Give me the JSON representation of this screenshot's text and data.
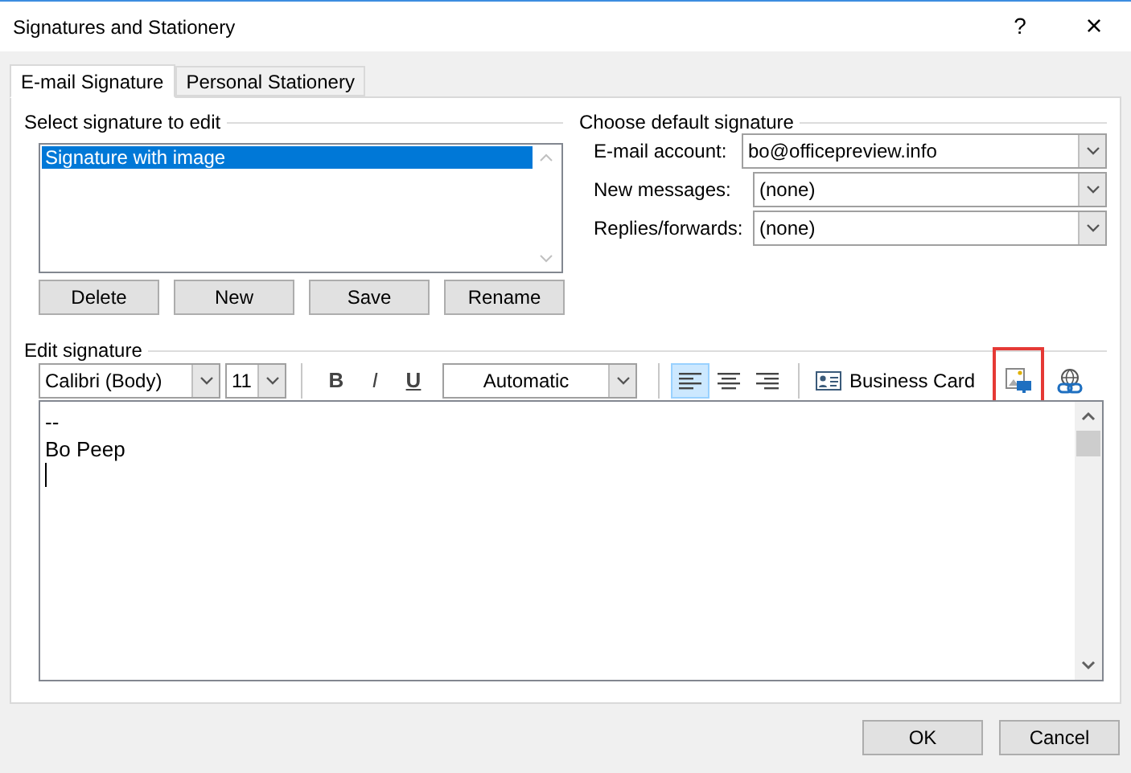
{
  "window": {
    "title": "Signatures and Stationery",
    "help": "?",
    "close": "×"
  },
  "tabs": [
    {
      "label": "E-mail Signature",
      "selected": true
    },
    {
      "label": "Personal Stationery",
      "selected": false
    }
  ],
  "select_signature": {
    "heading": "Select signature to edit",
    "items": [
      {
        "label": "Signature with image",
        "selected": true
      }
    ],
    "buttons": [
      "Delete",
      "New",
      "Save",
      "Rename"
    ]
  },
  "default_signature": {
    "heading": "Choose default signature",
    "fields": [
      {
        "label": "E-mail account:",
        "value": "bo@officepreview.info"
      },
      {
        "label": "New messages:",
        "value": "(none)"
      },
      {
        "label": "Replies/forwards:",
        "value": "(none)"
      }
    ]
  },
  "edit_signature": {
    "heading": "Edit signature",
    "font": "Calibri (Body)",
    "size": "11",
    "font_color": "Automatic",
    "tools": [
      {
        "kind": "bold",
        "label": "B",
        "selected": false,
        "highlighted": false
      },
      {
        "kind": "italic",
        "label": "I",
        "selected": false,
        "highlighted": false
      },
      {
        "kind": "underline",
        "label": "U",
        "selected": false,
        "highlighted": false
      },
      {
        "kind": "separator"
      },
      {
        "kind": "align-left",
        "selected": true,
        "highlighted": false
      },
      {
        "kind": "align-center",
        "selected": false,
        "highlighted": false
      },
      {
        "kind": "align-right",
        "selected": false,
        "highlighted": false
      },
      {
        "kind": "separator"
      },
      {
        "kind": "business-card",
        "label": "Business Card",
        "selected": false,
        "highlighted": false
      },
      {
        "kind": "picture",
        "selected": false,
        "highlighted": true
      },
      {
        "kind": "hyperlink",
        "selected": false,
        "highlighted": false
      }
    ],
    "lines": [
      "--",
      "Bo Peep"
    ]
  },
  "buttons": [
    "OK",
    "Cancel"
  ]
}
